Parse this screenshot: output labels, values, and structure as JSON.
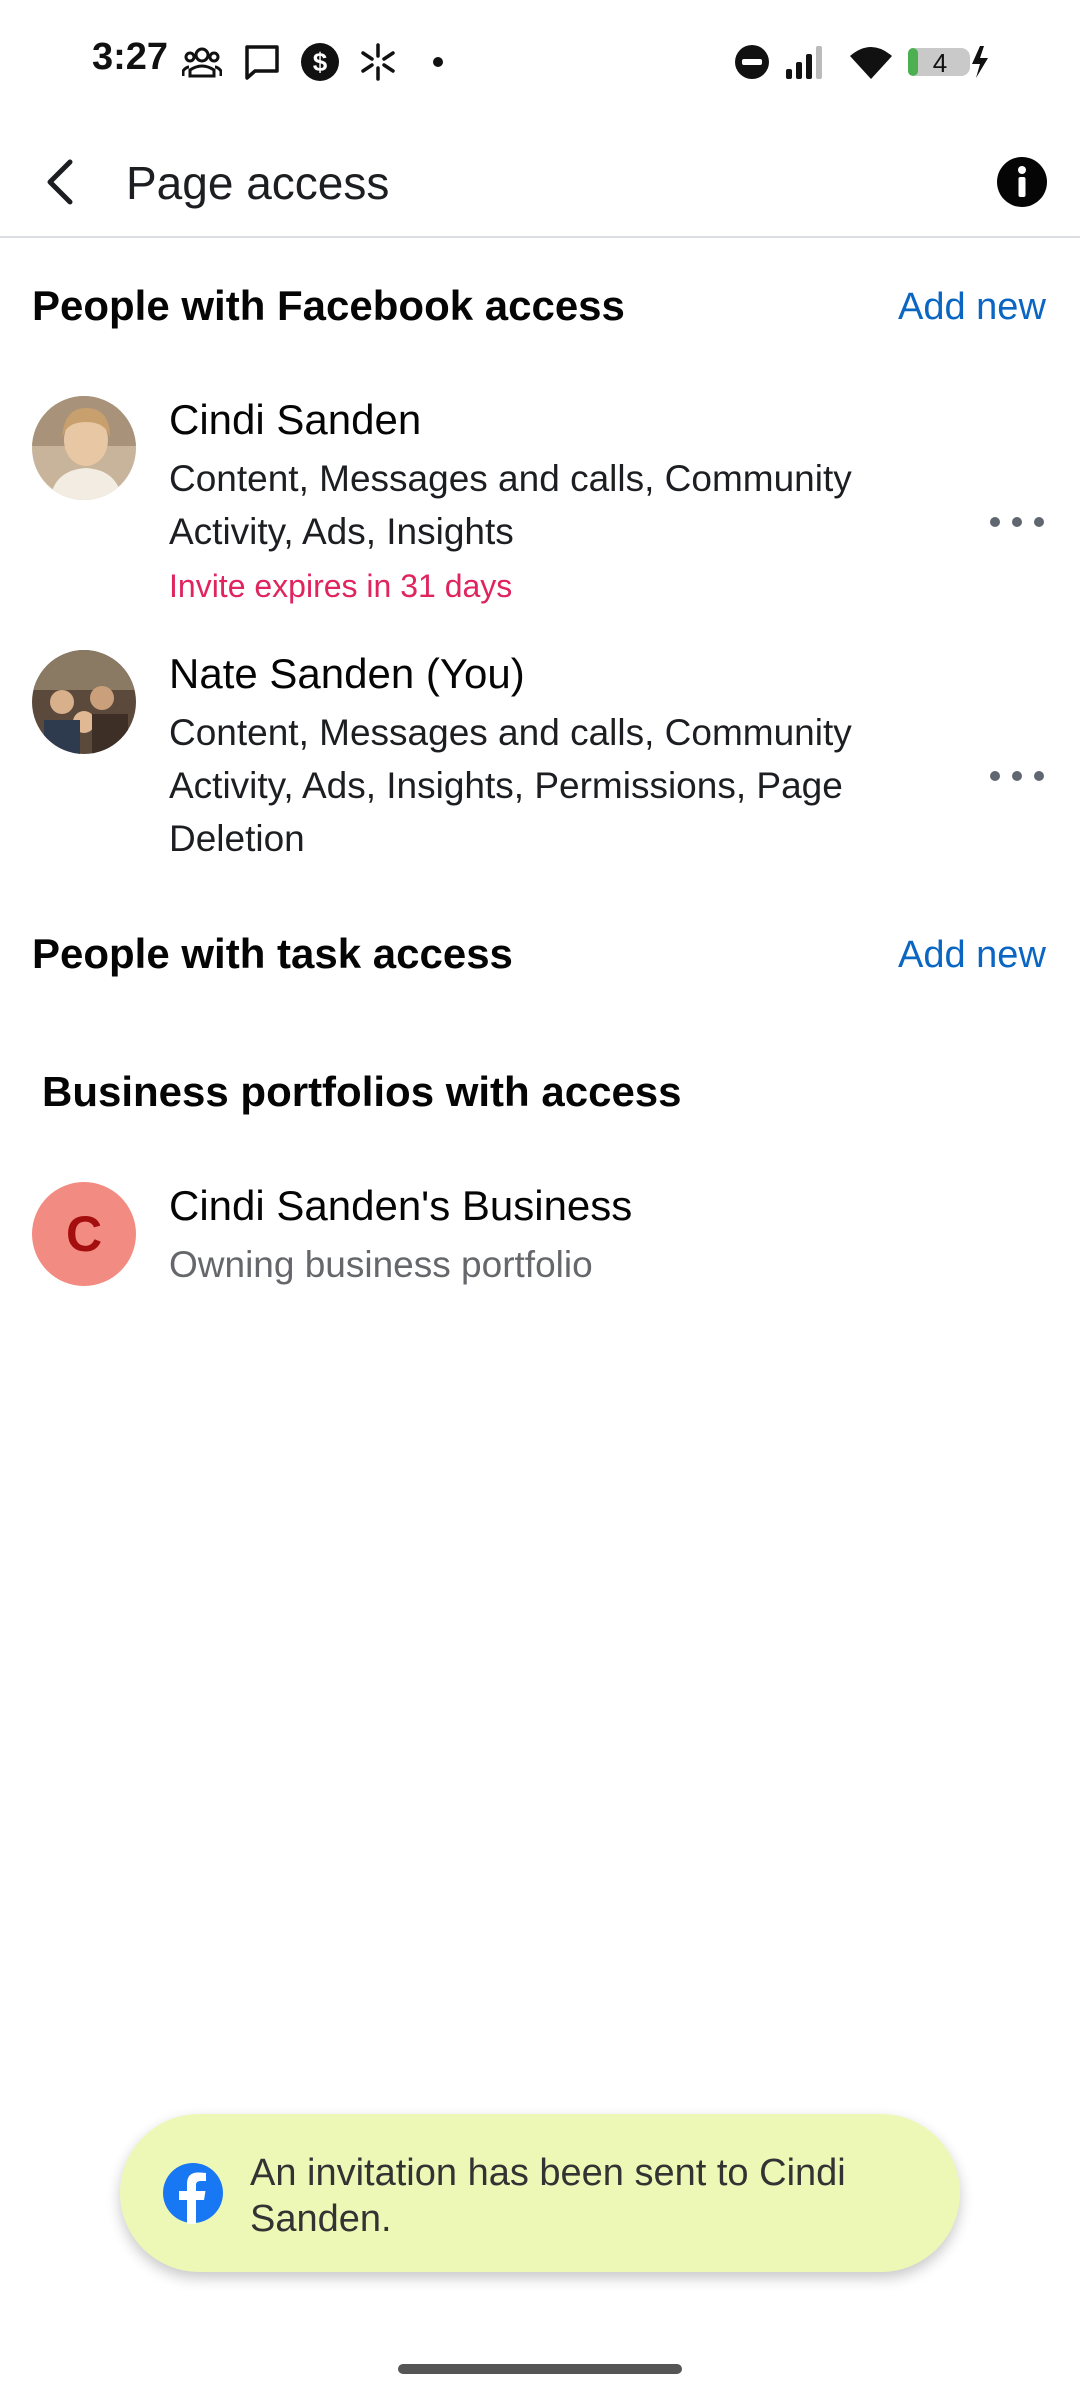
{
  "status_bar": {
    "time": "3:27",
    "battery_level": "4"
  },
  "app_bar": {
    "title": "Page access"
  },
  "facebook_access": {
    "title": "People with Facebook access",
    "add_new": "Add new",
    "people": [
      {
        "name": "Cindi Sanden",
        "permissions": "Content, Messages and calls, Community Activity, Ads, Insights",
        "status": "Invite expires in 31 days"
      },
      {
        "name": "Nate Sanden (You)",
        "permissions": "Content, Messages and calls, Community Activity, Ads, Insights, Permissions, Page Deletion"
      }
    ]
  },
  "task_access": {
    "title": "People with task access",
    "add_new": "Add new"
  },
  "business_portfolios": {
    "title": "Business portfolios with access",
    "items": [
      {
        "initial": "C",
        "name": "Cindi Sanden's Business",
        "subtitle": "Owning business portfolio"
      }
    ]
  },
  "toast": {
    "message": "An invitation has been sent to Cindi Sanden."
  },
  "colors": {
    "link": "#0a66c2",
    "invite_warning": "#e0245e",
    "business_avatar_bg": "#f28b82",
    "business_avatar_text": "#a50e0e",
    "toast_bg": "#eef8b6",
    "facebook_blue": "#1877f2"
  }
}
